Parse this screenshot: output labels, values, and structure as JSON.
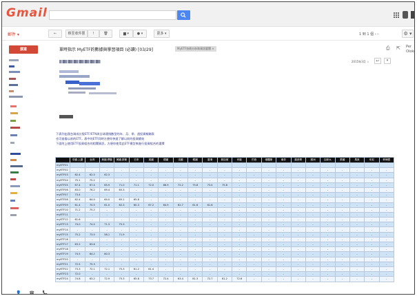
{
  "app": {
    "logo": "Gmail"
  },
  "search": {
    "placeholder": ""
  },
  "toolbar": {
    "mail_label": "郵件 ▾",
    "back": "←",
    "archive": "移至收件匣",
    "spam": "!",
    "delete": "🗑",
    "move": "▆ ▾",
    "labels": "● ▾",
    "more": "更多 ▾",
    "pager": "1 到 1 個  ‹  ›",
    "settings": "⚙ ▾"
  },
  "compose": {
    "label": "撰寫"
  },
  "message": {
    "subject": "單時指示 MyETF的數據與學習項目 (必讀) [03/29]",
    "tag": "MyETF技術分析和資訊要聞 ×",
    "date": "2015年3月 ☆",
    "right_panel": "Per Oloko…",
    "body_lines": [
      "下表列出我台灣成分股ETF/ETN與全球通指數型的年、月、季、週投資報酬表",
      "也可查看以前的ETF，表中的ETF同時方便你快速了解以前的投資績效",
      "下面附上使用ETF投資組合的相關資訊，方便你使用此ETF模型來進行投資組合的選擇"
    ]
  },
  "table": {
    "headers": [
      "",
      "中國-上證",
      "台灣",
      "美國-標普",
      "美國-那斯",
      "日本",
      "英國",
      "德國",
      "法國",
      "韓國",
      "香港",
      "新加坡",
      "印度",
      "巴西",
      "俄羅斯",
      "南非",
      "墨西哥",
      "澳洲",
      "加拿大",
      "泰國",
      "馬來",
      "印尼",
      "菲律賓"
    ],
    "rows": [
      [
        "myETF01",
        "",
        "",
        "",
        "",
        "",
        "",
        "",
        "",
        "",
        "",
        "",
        "",
        "",
        "",
        "",
        "",
        "",
        "",
        "",
        "",
        "",
        ""
      ],
      [
        "myETF02",
        "-",
        "-",
        "-",
        "-",
        "-",
        "-",
        "-",
        "-",
        "-",
        "-",
        "-",
        "-",
        "-",
        "-",
        "-",
        "-",
        "-",
        "-",
        "-",
        "-",
        "-",
        "-"
      ],
      [
        "myETF03",
        "62.4",
        "62.0",
        "62.3",
        "-",
        "-",
        "-",
        "-",
        "-",
        "-",
        "-",
        "-",
        "-",
        "-",
        "-",
        "-",
        "-",
        "-",
        "-",
        "-",
        "-",
        "-",
        "-"
      ],
      [
        "myETF04",
        "75.1",
        "75.2",
        "-",
        "-",
        "-",
        "-",
        "-",
        "-",
        "-",
        "-",
        "-",
        "-",
        "-",
        "-",
        "-",
        "-",
        "-",
        "-",
        "-",
        "-",
        "-",
        "-"
      ],
      [
        "myETF05",
        "67.4",
        "67.4",
        "65.9",
        "71.0",
        "71.1",
        "72.0",
        "66.9",
        "72.2",
        "75.8",
        "73.4",
        "75.8",
        "-",
        "-",
        "-",
        "-",
        "-",
        "-",
        "-",
        "-",
        "-",
        "-",
        "-"
      ],
      [
        "myETF06",
        "83.0",
        "76.2",
        "69.4",
        "65.3",
        "-",
        "-",
        "-",
        "-",
        "-",
        "-",
        "-",
        "-",
        "-",
        "-",
        "-",
        "-",
        "-",
        "-",
        "-",
        "-",
        "-",
        "-"
      ],
      [
        "myETF07",
        "73.4",
        "-",
        "-",
        "-",
        "-",
        "-",
        "-",
        "-",
        "-",
        "-",
        "-",
        "-",
        "-",
        "-",
        "-",
        "-",
        "-",
        "-",
        "-",
        "-",
        "-",
        "-"
      ],
      [
        "myETF08",
        "62.4",
        "64.0",
        "64.0",
        "65.1",
        "65.8",
        "-",
        "-",
        "-",
        "-",
        "-",
        "-",
        "-",
        "-",
        "-",
        "-",
        "-",
        "-",
        "-",
        "-",
        "-",
        "-",
        "-"
      ],
      [
        "myETF09",
        "61.4",
        "70.5",
        "61.0",
        "62.3",
        "60.3",
        "67.2",
        "64.9",
        "62.7",
        "61.6",
        "61.6",
        "-",
        "-",
        "-",
        "-",
        "-",
        "-",
        "-",
        "-",
        "-",
        "-",
        "-",
        "-"
      ],
      [
        "myETF10",
        "71.2",
        "75.2",
        "-",
        "-",
        "-",
        "-",
        "-",
        "-",
        "-",
        "-",
        "-",
        "-",
        "-",
        "-",
        "-",
        "-",
        "-",
        "-",
        "-",
        "-",
        "-",
        "-"
      ],
      [
        "myETF11",
        "-",
        "-",
        "-",
        "-",
        "-",
        "-",
        "-",
        "-",
        "-",
        "-",
        "-",
        "-",
        "-",
        "-",
        "-",
        "-",
        "-",
        "-",
        "-",
        "-",
        "-",
        "-"
      ],
      [
        "myETF12",
        "61.6",
        "-",
        "-",
        "-",
        "-",
        "-",
        "-",
        "-",
        "-",
        "-",
        "-",
        "-",
        "-",
        "-",
        "-",
        "-",
        "-",
        "-",
        "-",
        "-",
        "-",
        "-"
      ],
      [
        "myETF13",
        "74.0",
        "74.0",
        "71.3",
        "75.3",
        "-",
        "-",
        "-",
        "-",
        "-",
        "-",
        "-",
        "-",
        "-",
        "-",
        "-",
        "-",
        "-",
        "-",
        "-",
        "-",
        "-",
        "-"
      ],
      [
        "myETF14",
        "-",
        "-",
        "-",
        "-",
        "-",
        "-",
        "-",
        "-",
        "-",
        "-",
        "-",
        "-",
        "-",
        "-",
        "-",
        "-",
        "-",
        "-",
        "-",
        "-",
        "-",
        "-"
      ],
      [
        "myETF15",
        "75.2",
        "73.0",
        "58.1",
        "71.9",
        "-",
        "-",
        "-",
        "-",
        "-",
        "-",
        "-",
        "-",
        "-",
        "-",
        "-",
        "-",
        "-",
        "-",
        "-",
        "-",
        "-",
        "-"
      ],
      [
        "myETF16",
        "-",
        "-",
        "-",
        "-",
        "-",
        "-",
        "-",
        "-",
        "-",
        "-",
        "-",
        "-",
        "-",
        "-",
        "-",
        "-",
        "-",
        "-",
        "-",
        "-",
        "-",
        "-"
      ],
      [
        "myETF17",
        "63.2",
        "63.6",
        "-",
        "-",
        "-",
        "-",
        "-",
        "-",
        "-",
        "-",
        "-",
        "-",
        "-",
        "-",
        "-",
        "-",
        "-",
        "-",
        "-",
        "-",
        "-",
        "-"
      ],
      [
        "myETF18",
        "-",
        "-",
        "-",
        "-",
        "-",
        "-",
        "-",
        "-",
        "-",
        "-",
        "-",
        "-",
        "-",
        "-",
        "-",
        "-",
        "-",
        "-",
        "-",
        "-",
        "-",
        "-"
      ],
      [
        "myETF19",
        "74.5",
        "84.2",
        "80.3",
        "-",
        "-",
        "-",
        "-",
        "-",
        "-",
        "-",
        "-",
        "-",
        "-",
        "-",
        "-",
        "-",
        "-",
        "-",
        "-",
        "-",
        "-",
        "-"
      ],
      [
        "myETF20",
        "-",
        "-",
        "-",
        "-",
        "-",
        "-",
        "-",
        "-",
        "-",
        "-",
        "-",
        "-",
        "-",
        "-",
        "-",
        "-",
        "-",
        "-",
        "-",
        "-",
        "-",
        "-"
      ],
      [
        "myETF21",
        "72.5",
        "75.3",
        "-",
        "-",
        "-",
        "-",
        "-",
        "-",
        "-",
        "-",
        "-",
        "-",
        "-",
        "-",
        "-",
        "-",
        "-",
        "-",
        "-",
        "-",
        "-",
        "-"
      ],
      [
        "myETF22",
        "73.3",
        "72.1",
        "72.1",
        "75.3",
        "61.2",
        "61.4",
        "-",
        "-",
        "-",
        "-",
        "-",
        "-",
        "-",
        "-",
        "-",
        "-",
        "-",
        "-",
        "-",
        "-",
        "-",
        "-"
      ],
      [
        "myETF23",
        "72.0",
        "-",
        "-",
        "-",
        "-",
        "-",
        "-",
        "-",
        "-",
        "-",
        "-",
        "-",
        "-",
        "-",
        "-",
        "-",
        "-",
        "-",
        "-",
        "-",
        "-",
        "-"
      ],
      [
        "myETF24",
        "74.8",
        "63.2",
        "72.9",
        "75.3",
        "65.8",
        "73.7",
        "72.4",
        "63.4",
        "81.3",
        "72.7",
        "81.2",
        "72.6",
        "-",
        "-",
        "-",
        "-",
        "-",
        "-",
        "-",
        "-",
        "-",
        "-"
      ]
    ]
  },
  "footer": {
    "icons": "👤 ☎ 📞"
  },
  "colors": {
    "accent_red": "#d14836",
    "search_blue": "#4d86f0",
    "table_header": "#111111",
    "table_row_a": "#cfe3f7",
    "table_row_b": "#eef5fc"
  }
}
